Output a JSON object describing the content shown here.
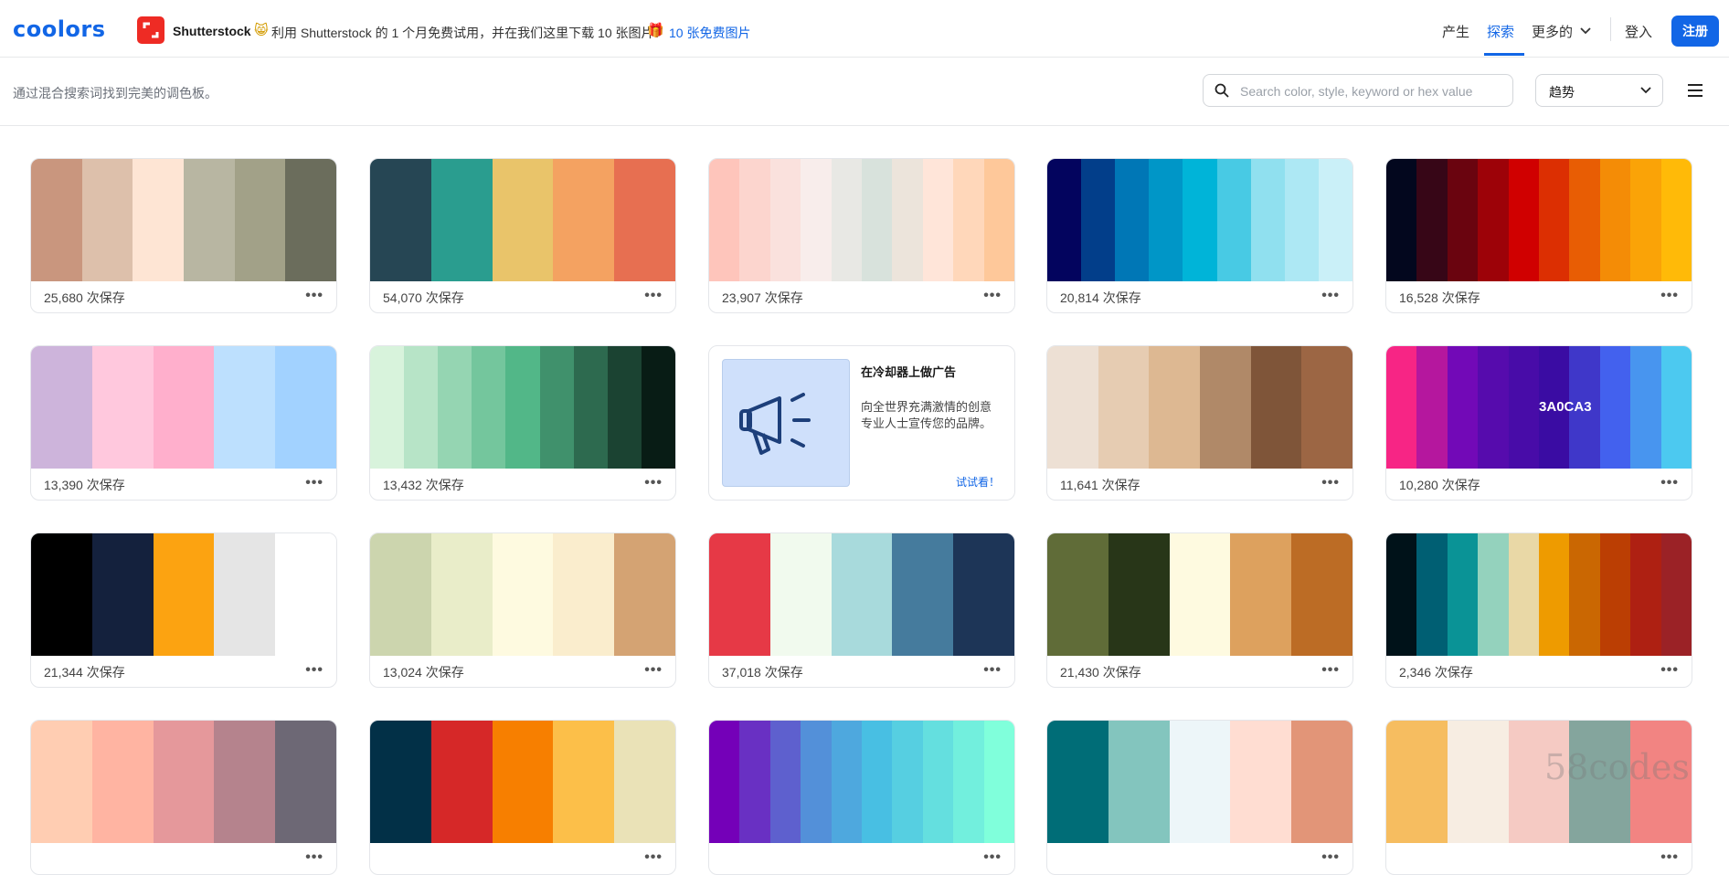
{
  "brand": {
    "logo": "coolors"
  },
  "promo": {
    "partner": "Shutterstock",
    "text": "利用 Shutterstock 的 1 个月免费试用，并在我们这里下载 10 张图片！",
    "link": "10 张免费图片"
  },
  "nav": {
    "items": [
      "产生",
      "探索",
      "更多的"
    ],
    "active": "探索",
    "login": "登入",
    "signup": "注册"
  },
  "subbar": {
    "subtitle": "通过混合搜索词找到完美的调色板。",
    "search_placeholder": "Search color, style, keyword or hex value",
    "sort_value": "趋势"
  },
  "palettes": [
    {
      "saves": "25,680 次保存",
      "colors": [
        "#c9967e",
        "#ddc0ab",
        "#fee5d4",
        "#b8b6a2",
        "#a2a188",
        "#6b6d5c"
      ]
    },
    {
      "saves": "54,070 次保存",
      "colors": [
        "#264654",
        "#2a9d8f",
        "#e9c46a",
        "#f4a261",
        "#e76f51"
      ]
    },
    {
      "saves": "23,907 次保存",
      "colors": [
        "#fec5bb",
        "#fcd5ce",
        "#fae1dd",
        "#f8edeb",
        "#e8e8e4",
        "#d8e2dc",
        "#ece4db",
        "#ffe5d9",
        "#ffd7ba",
        "#fec89a"
      ]
    },
    {
      "saves": "20,814 次保存",
      "colors": [
        "#03045e",
        "#023e8a",
        "#0077b6",
        "#0096c7",
        "#00b4d8",
        "#48cae4",
        "#90e0ef",
        "#ade8f4",
        "#caf0f8"
      ]
    },
    {
      "saves": "16,528 次保存",
      "colors": [
        "#03071e",
        "#370617",
        "#6a040f",
        "#9d0208",
        "#d00000",
        "#dc2f02",
        "#e85d04",
        "#f48c06",
        "#faa307",
        "#ffba08"
      ]
    },
    {
      "saves": "13,390 次保存",
      "colors": [
        "#cdb4db",
        "#ffc8dd",
        "#ffafcc",
        "#bde0fe",
        "#a2d2ff"
      ]
    },
    {
      "saves": "13,432 次保存",
      "colors": [
        "#d8f3dc",
        "#b7e4c7",
        "#95d5b2",
        "#74c69d",
        "#52b788",
        "#40916c",
        "#2d6a4f",
        "#1b4332",
        "#081c15"
      ]
    },
    {
      "saves": "11,641 次保存",
      "colors": [
        "#ede0d4",
        "#e6ccb2",
        "#ddb892",
        "#b08968",
        "#7f5539",
        "#9c6644"
      ]
    },
    {
      "saves": "10,280 次保存",
      "hex_label": "3A0CA3",
      "colors": [
        "#f72585",
        "#b5179e",
        "#7209b7",
        "#560bad",
        "#480ca8",
        "#3a0ca3",
        "#3f37c9",
        "#4361ee",
        "#4895ef",
        "#4cc9f0"
      ]
    },
    {
      "saves": "21,344 次保存",
      "colors": [
        "#000000",
        "#14213d",
        "#fca311",
        "#e5e5e5",
        "#ffffff"
      ]
    },
    {
      "saves": "13,024 次保存",
      "colors": [
        "#ccd5ae",
        "#e9edc9",
        "#fefae0",
        "#faedcd",
        "#d4a373"
      ]
    },
    {
      "saves": "37,018 次保存",
      "colors": [
        "#e63946",
        "#f1faee",
        "#a8dadc",
        "#457b9d",
        "#1d3557"
      ]
    },
    {
      "saves": "21,430 次保存",
      "colors": [
        "#606c38",
        "#283618",
        "#fefae0",
        "#dda15e",
        "#bc6c25"
      ]
    },
    {
      "saves": "2,346 次保存",
      "colors": [
        "#001219",
        "#005f73",
        "#0a9396",
        "#94d2bd",
        "#e9d8a6",
        "#ee9b00",
        "#ca6702",
        "#bb3e03",
        "#ae2012",
        "#9b2226"
      ]
    },
    {
      "saves": "",
      "colors": [
        "#ffcdb2",
        "#ffb4a2",
        "#e5989b",
        "#b5838d",
        "#6d6875"
      ]
    },
    {
      "saves": "",
      "colors": [
        "#023047",
        "#d62828",
        "#f77f00",
        "#fcbf49",
        "#eae2b7"
      ]
    },
    {
      "saves": "",
      "colors": [
        "#7400b8",
        "#6930c3",
        "#5e60ce",
        "#5390d9",
        "#4ea8de",
        "#48bfe3",
        "#56cfe1",
        "#64dfdf",
        "#72efdd",
        "#80ffdb"
      ]
    },
    {
      "saves": "",
      "colors": [
        "#006d77",
        "#83c5be",
        "#edf6f9",
        "#ffddd2",
        "#e29578"
      ]
    },
    {
      "saves": "",
      "colors": [
        "#f6bd60",
        "#f7ede2",
        "#f5cac3",
        "#84a59d",
        "#f28482"
      ]
    }
  ],
  "ad": {
    "title": "在冷却器上做广告",
    "description": "向全世界充满激情的创意专业人士宣传您的品牌。",
    "cta": "试试看！"
  },
  "watermark": "58codes"
}
